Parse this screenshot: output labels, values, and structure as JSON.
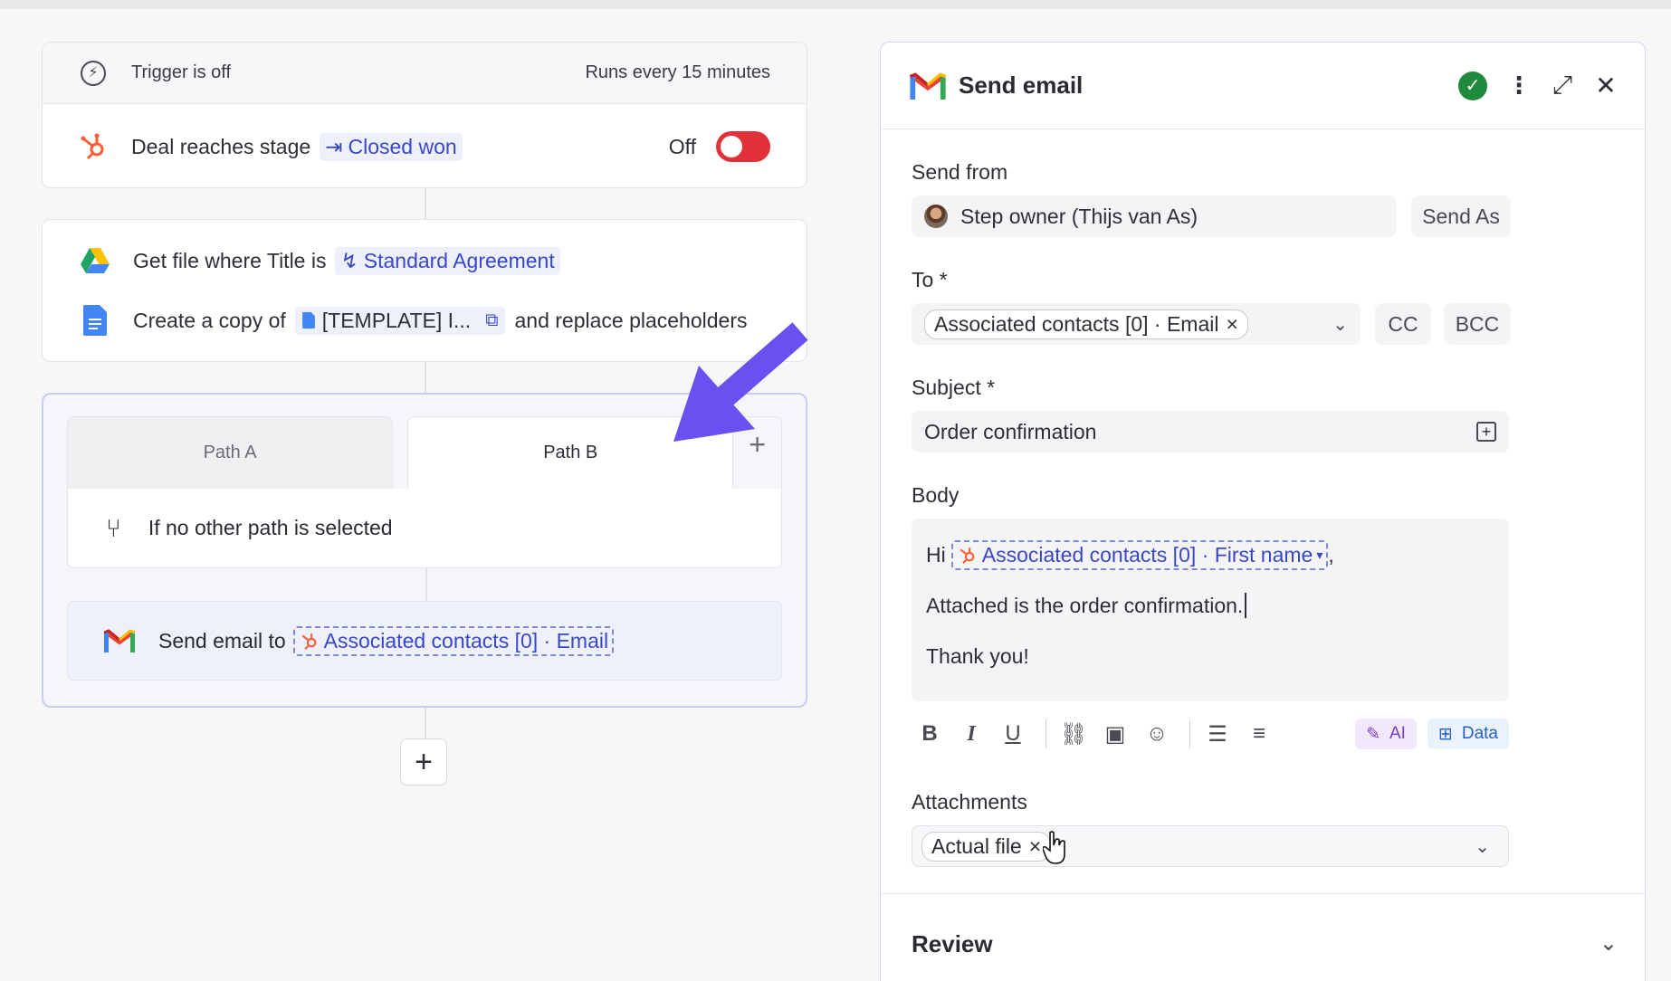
{
  "trigger": {
    "status": "Trigger is off",
    "schedule": "Runs every 15 minutes",
    "event_prefix": "Deal reaches stage",
    "stage": "Closed won",
    "toggle_label": "Off"
  },
  "actions": {
    "get_file_prefix": "Get file where Title is",
    "get_file_value": "Standard Agreement",
    "copy_prefix": "Create a copy of",
    "copy_doc": "[TEMPLATE] I...",
    "copy_suffix": "and replace placeholders"
  },
  "paths": {
    "tabs": [
      {
        "label": "Path A",
        "active": false
      },
      {
        "label": "Path B",
        "active": true
      }
    ],
    "condition": "If no other path is selected",
    "send_prefix": "Send email to",
    "send_value": "Associated contacts [0] · Email"
  },
  "panel": {
    "title": "Send email",
    "send_from": {
      "label": "Send from",
      "value": "Step owner (Thijs van As)",
      "send_as": "Send As"
    },
    "to": {
      "label": "To *",
      "tag": "Associated contacts [0] · Email",
      "cc": "CC",
      "bcc": "BCC"
    },
    "subject": {
      "label": "Subject *",
      "value": "Order confirmation"
    },
    "body": {
      "label": "Body",
      "greeting": "Hi",
      "first_name_token": "Associated contacts [0] · First name",
      "line2": "Attached is the order confirmation.",
      "line3": "Thank you!"
    },
    "toolbar": {
      "ai_label": "AI",
      "data_label": "Data"
    },
    "attachments": {
      "label": "Attachments",
      "tag": "Actual file"
    },
    "review": "Review"
  },
  "colors": {
    "accent": "#3848c8",
    "toggle_off": "#e0313b",
    "success": "#1f8a3b",
    "arrow": "#6b4ff0"
  }
}
